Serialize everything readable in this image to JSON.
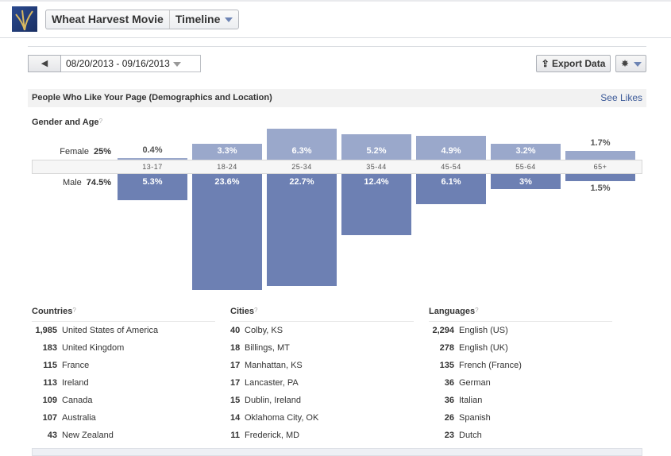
{
  "header": {
    "page_name": "Wheat Harvest Movie",
    "view_menu": "Timeline",
    "logo_icon": "wheat-logo"
  },
  "toolbar": {
    "prev_icon": "◀",
    "date_range": "08/20/2013 - 09/16/2013",
    "export_label": "Export Data",
    "export_icon": "⇪",
    "gear_icon": "✸"
  },
  "section": {
    "title": "People Who Like Your Page (Demographics and Location)",
    "see_likes": "See Likes"
  },
  "gender_age": {
    "title": "Gender and Age",
    "help": "?",
    "female_label": "Female",
    "female_total": "25%",
    "male_label": "Male",
    "male_total": "74.5%"
  },
  "colors": {
    "female": "#9aa8cb",
    "male": "#6d80b3",
    "link": "#3b5998"
  },
  "chart_data": {
    "type": "bar",
    "categories": [
      "13-17",
      "18-24",
      "25-34",
      "35-44",
      "45-54",
      "55-64",
      "65+"
    ],
    "series": [
      {
        "name": "Female",
        "values": [
          0.4,
          3.3,
          6.3,
          5.2,
          4.9,
          3.2,
          1.7
        ],
        "labels": [
          "0.4%",
          "3.3%",
          "6.3%",
          "5.2%",
          "4.9%",
          "3.2%",
          "1.7%"
        ]
      },
      {
        "name": "Male",
        "values": [
          5.3,
          23.6,
          22.7,
          12.4,
          6.1,
          3,
          1.5
        ],
        "labels": [
          "5.3%",
          "23.6%",
          "22.7%",
          "12.4%",
          "6.1%",
          "3%",
          "1.5%"
        ]
      }
    ]
  },
  "countries": {
    "title": "Countries",
    "help": "?",
    "rows": [
      {
        "n": "1,985",
        "name": "United States of America"
      },
      {
        "n": "183",
        "name": "United Kingdom"
      },
      {
        "n": "115",
        "name": "France"
      },
      {
        "n": "113",
        "name": "Ireland"
      },
      {
        "n": "109",
        "name": "Canada"
      },
      {
        "n": "107",
        "name": "Australia"
      },
      {
        "n": "43",
        "name": "New Zealand"
      }
    ]
  },
  "cities": {
    "title": "Cities",
    "help": "?",
    "rows": [
      {
        "n": "40",
        "name": "Colby, KS"
      },
      {
        "n": "18",
        "name": "Billings, MT"
      },
      {
        "n": "17",
        "name": "Manhattan, KS"
      },
      {
        "n": "17",
        "name": "Lancaster, PA"
      },
      {
        "n": "15",
        "name": "Dublin, Ireland"
      },
      {
        "n": "14",
        "name": "Oklahoma City, OK"
      },
      {
        "n": "11",
        "name": "Frederick, MD"
      }
    ]
  },
  "languages": {
    "title": "Languages",
    "help": "?",
    "rows": [
      {
        "n": "2,294",
        "name": "English (US)"
      },
      {
        "n": "278",
        "name": "English (UK)"
      },
      {
        "n": "135",
        "name": "French (France)"
      },
      {
        "n": "36",
        "name": "German"
      },
      {
        "n": "36",
        "name": "Italian"
      },
      {
        "n": "26",
        "name": "Spanish"
      },
      {
        "n": "23",
        "name": "Dutch"
      }
    ]
  }
}
